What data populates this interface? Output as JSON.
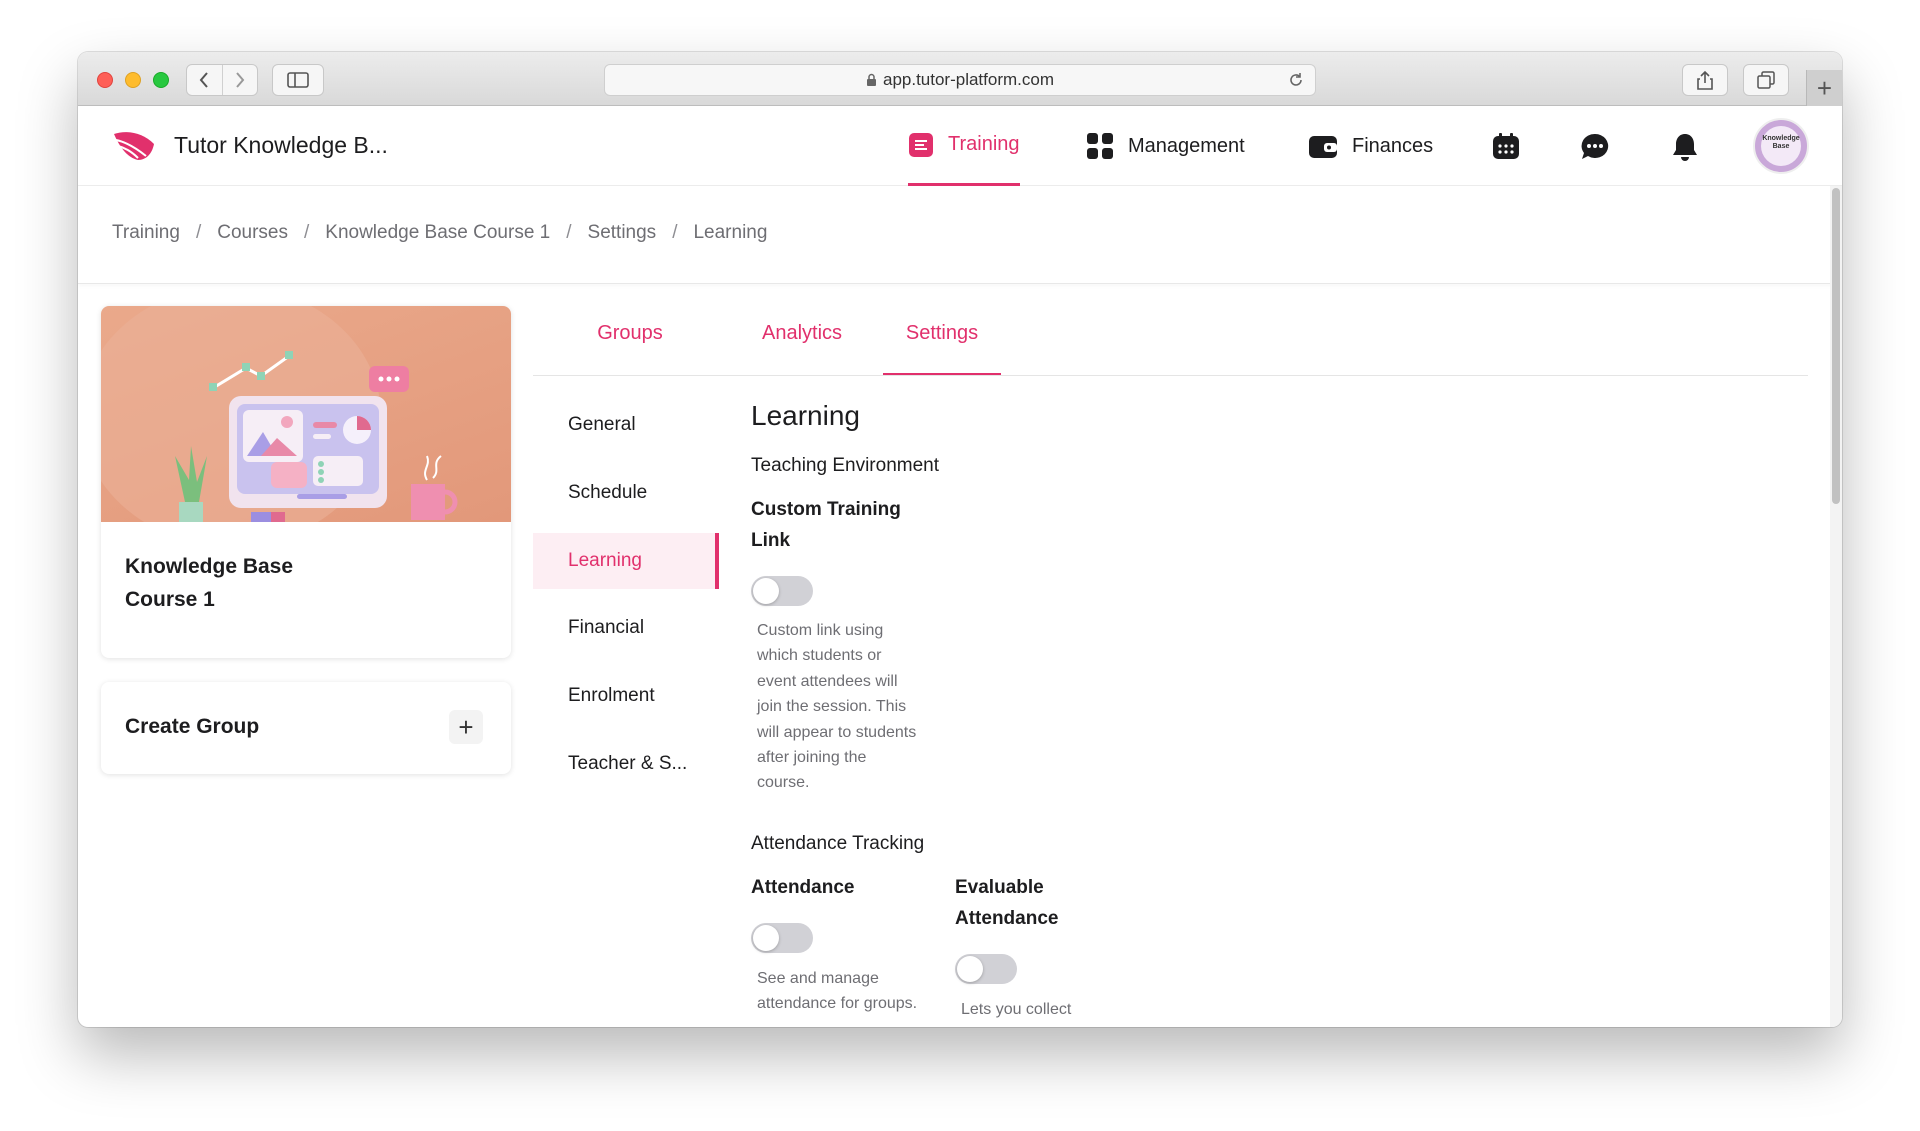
{
  "browser": {
    "url": "app.tutor-platform.com"
  },
  "header": {
    "brand": "Tutor Knowledge B...",
    "nav": [
      {
        "label": "Training"
      },
      {
        "label": "Management"
      },
      {
        "label": "Finances"
      }
    ],
    "avatar_text": "Knowledge Base",
    "accent_color": "#e1306c"
  },
  "breadcrumb": [
    "Training",
    "Courses",
    "Knowledge Base Course 1",
    "Settings",
    "Learning"
  ],
  "course": {
    "title_line1": "Knowledge Base",
    "title_line2": "Course 1"
  },
  "create_group": {
    "label": "Create Group",
    "plus": "+"
  },
  "tabs": [
    {
      "label": "Groups"
    },
    {
      "label": "Analytics"
    },
    {
      "label": "Settings",
      "active": true
    }
  ],
  "settings_menu": [
    {
      "label": "General"
    },
    {
      "label": "Schedule"
    },
    {
      "label": "Learning",
      "active": true
    },
    {
      "label": "Financial"
    },
    {
      "label": "Enrolment"
    },
    {
      "label": "Teacher & S..."
    }
  ],
  "content": {
    "title": "Learning",
    "teaching_env": {
      "heading": "Teaching Environment",
      "custom_link_label_1": "Custom Training",
      "custom_link_label_2": "Link",
      "custom_link_enabled": false,
      "custom_link_help": [
        "Custom link using",
        "which students or",
        "event attendees will",
        "join the session. This",
        "will appear to students",
        "after joining the",
        "course."
      ]
    },
    "attendance": {
      "heading": "Attendance Tracking",
      "attendance_label": "Attendance",
      "attendance_enabled": false,
      "attendance_help": [
        "See and manage",
        "attendance for groups."
      ],
      "evaluable_label_1": "Evaluable",
      "evaluable_label_2": "Attendance",
      "evaluable_enabled": false,
      "evaluable_help": [
        "Lets you collect"
      ]
    }
  }
}
